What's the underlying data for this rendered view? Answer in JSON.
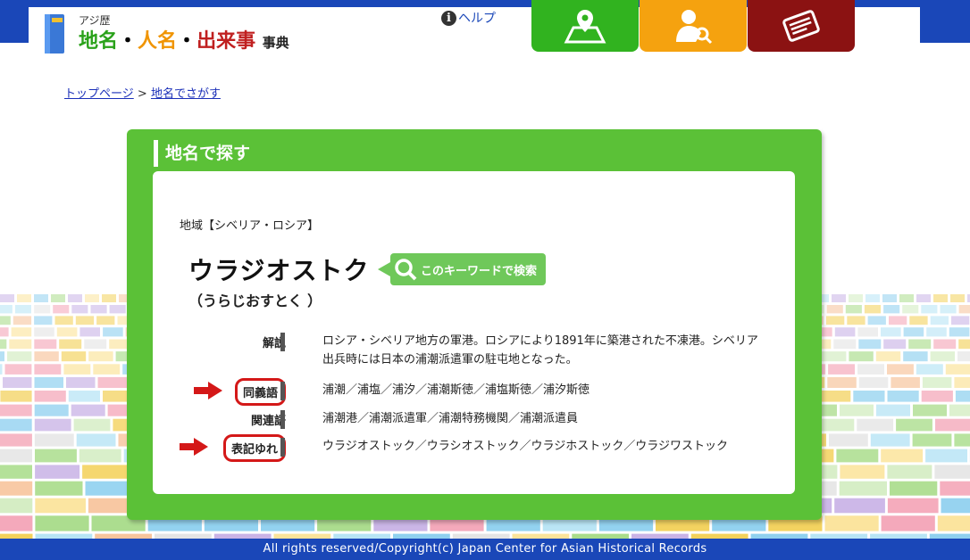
{
  "header": {
    "logo_small": "アジ歴",
    "logo_part1": "地名",
    "logo_part2": "人名",
    "logo_part3": "出来事",
    "logo_suffix": "事典",
    "logo_sep": "・",
    "help_label": "ヘルプ"
  },
  "breadcrumb": {
    "home": "トップページ",
    "sep": ">",
    "current": "地名でさがす"
  },
  "panel": {
    "title": "地名で探す",
    "region": "地域【シベリア・ロシア】",
    "term": "ウラジオストク",
    "reading": "（うらじおすとく ）",
    "keyword_search_label": "このキーワードで検索"
  },
  "rows": [
    {
      "label": "解説",
      "text": "ロシア・シベリア地方の軍港。ロシアにより1891年に築港された不凍港。シベリア出兵時には日本の浦潮派遣軍の駐屯地となった。"
    },
    {
      "label": "同義語",
      "text": "浦潮／浦塩／浦汐／浦潮斯徳／浦塩斯徳／浦汐斯徳"
    },
    {
      "label": "関連語",
      "text": "浦潮港／浦潮派遣軍／浦潮特務機関／浦潮派遣員"
    },
    {
      "label": "表記ゆれ",
      "text": "ウラジオストック／ウラシオストック／ウラジホストック／ウラジワストック"
    }
  ],
  "footer": "All rights reserved/Copyright(c) Japan Center for Asian Historical Records",
  "icons": [
    "map-pin-icon",
    "person-search-icon",
    "newspaper-icon",
    "help-icon",
    "magnifier-icon",
    "red-arrow-icon"
  ],
  "colors": {
    "brand_blue": "#1a47b8",
    "panel_green": "#5bc137",
    "nav_green": "#31b31f",
    "nav_orange": "#f5a20f",
    "nav_maroon": "#8b1212",
    "highlight_red": "#d41818"
  }
}
